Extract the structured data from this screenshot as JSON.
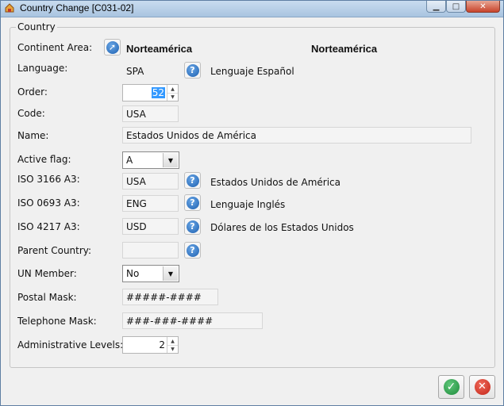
{
  "window": {
    "title": "Country Change [C031-02]",
    "minimize_icon": "minimize-icon",
    "maximize_icon": "maximize-icon",
    "close_icon": "close-icon"
  },
  "group": {
    "title": "Country"
  },
  "labels": {
    "continent_area": "Continent Area:",
    "language": "Language:",
    "order": "Order:",
    "code": "Code:",
    "name": "Name:",
    "active_flag": "Active flag:",
    "iso3166": "ISO 3166 A3:",
    "iso0693": "ISO 0693 A3:",
    "iso4217": "ISO 4217 A3:",
    "parent_country": "Parent Country:",
    "un_member": "UN Member:",
    "postal_mask": "Postal Mask:",
    "telephone_mask": "Telephone Mask:",
    "admin_levels": "Administrative Levels:"
  },
  "values": {
    "continent_code": "Norteamérica",
    "continent_desc": "Norteamérica",
    "language_code": "SPA",
    "language_desc": "Lenguaje Español",
    "order": "52",
    "code": "USA",
    "name": "Estados Unidos de América",
    "active_flag": "A",
    "iso3166_code": "USA",
    "iso3166_desc": "Estados Unidos de América",
    "iso0693_code": "ENG",
    "iso0693_desc": "Lenguaje Inglés",
    "iso4217_code": "USD",
    "iso4217_desc": "Dólares de los Estados Unidos",
    "parent_country": "",
    "un_member": "No",
    "postal_mask": "#####-####",
    "telephone_mask": "###-###-####",
    "admin_levels": "2"
  },
  "icons": {
    "lookup": "question-icon",
    "navigate": "arrow-link-icon",
    "ok": "check-icon",
    "cancel": "cancel-icon"
  },
  "colors": {
    "accent": "#1c5fb0",
    "ok": "#1d8a3a",
    "cancel": "#c22418",
    "selection": "#3399ff"
  }
}
